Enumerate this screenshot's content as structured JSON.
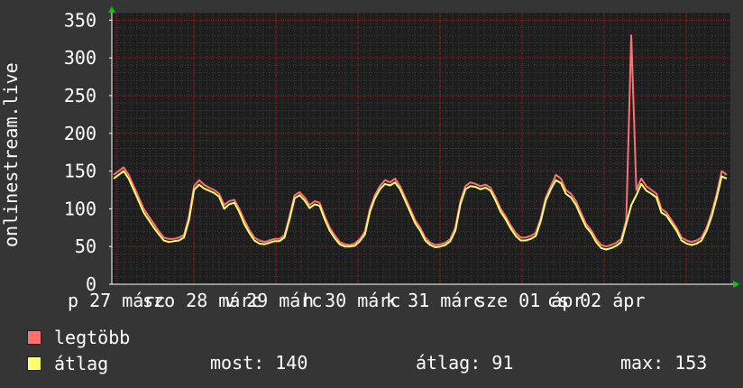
{
  "chart_data": {
    "type": "line",
    "ylabel": "onlinestream.live",
    "ylim": [
      0,
      360
    ],
    "y_ticks": [
      "0",
      "50",
      "100",
      "150",
      "200",
      "250",
      "300",
      "350"
    ],
    "x_tick_labels": [
      "p 27 márc",
      "szo 28 márc",
      "v 29 márc",
      "h 30 márc",
      "k 31 márc",
      "sze 01 ápr",
      "cs 02 ápr"
    ],
    "grid": true,
    "series": [
      {
        "name": "legtöbb",
        "color": "#ff7070",
        "values": [
          145,
          150,
          155,
          145,
          130,
          115,
          100,
          90,
          80,
          70,
          62,
          60,
          60,
          62,
          65,
          90,
          130,
          138,
          132,
          128,
          125,
          120,
          105,
          110,
          112,
          100,
          85,
          72,
          62,
          58,
          56,
          58,
          60,
          60,
          65,
          90,
          118,
          122,
          115,
          105,
          110,
          108,
          90,
          75,
          65,
          56,
          53,
          52,
          54,
          60,
          70,
          100,
          118,
          130,
          138,
          135,
          140,
          130,
          115,
          100,
          85,
          75,
          62,
          55,
          52,
          53,
          55,
          60,
          75,
          110,
          130,
          135,
          133,
          130,
          132,
          128,
          115,
          100,
          90,
          78,
          68,
          62,
          62,
          64,
          68,
          88,
          115,
          130,
          145,
          140,
          125,
          120,
          110,
          95,
          80,
          72,
          60,
          52,
          50,
          52,
          55,
          60,
          85,
          330,
          125,
          140,
          130,
          125,
          120,
          100,
          95,
          85,
          75,
          62,
          58,
          56,
          58,
          62,
          75,
          95,
          120,
          150,
          145
        ],
        "spikes": [
          {
            "value": 330
          }
        ]
      },
      {
        "name": "átlag",
        "color": "#ffff70",
        "values": [
          140,
          145,
          150,
          140,
          125,
          110,
          95,
          85,
          75,
          66,
          58,
          56,
          57,
          58,
          62,
          85,
          125,
          132,
          127,
          124,
          121,
          116,
          100,
          106,
          108,
          96,
          80,
          68,
          58,
          54,
          53,
          55,
          57,
          57,
          62,
          86,
          114,
          118,
          111,
          101,
          106,
          104,
          86,
          71,
          61,
          53,
          50,
          50,
          51,
          57,
          66,
          96,
          114,
          126,
          133,
          131,
          135,
          126,
          111,
          96,
          81,
          71,
          58,
          52,
          49,
          50,
          52,
          57,
          71,
          106,
          126,
          130,
          129,
          126,
          128,
          124,
          111,
          96,
          86,
          74,
          64,
          58,
          58,
          60,
          64,
          84,
          111,
          126,
          138,
          134,
          120,
          115,
          105,
          90,
          76,
          68,
          56,
          48,
          46,
          48,
          51,
          56,
          80,
          105,
          118,
          133,
          124,
          120,
          115,
          95,
          91,
          81,
          71,
          58,
          54,
          52,
          54,
          58,
          71,
          90,
          115,
          143,
          140
        ]
      }
    ]
  },
  "legend": {
    "items": [
      {
        "label": "legtöbb",
        "color": "#ff7070"
      },
      {
        "label": "átlag",
        "color": "#ffff70"
      }
    ],
    "stats": {
      "now": "most: 140",
      "avg": "átlag: 91",
      "max": "max: 153"
    }
  },
  "colors": {
    "background": "#353535",
    "plot_background": "#1e1e1e",
    "grid_major": "#7a2a2a",
    "grid_minor": "#444444",
    "axis": "#ffffff",
    "arrow": "#00cc00"
  }
}
